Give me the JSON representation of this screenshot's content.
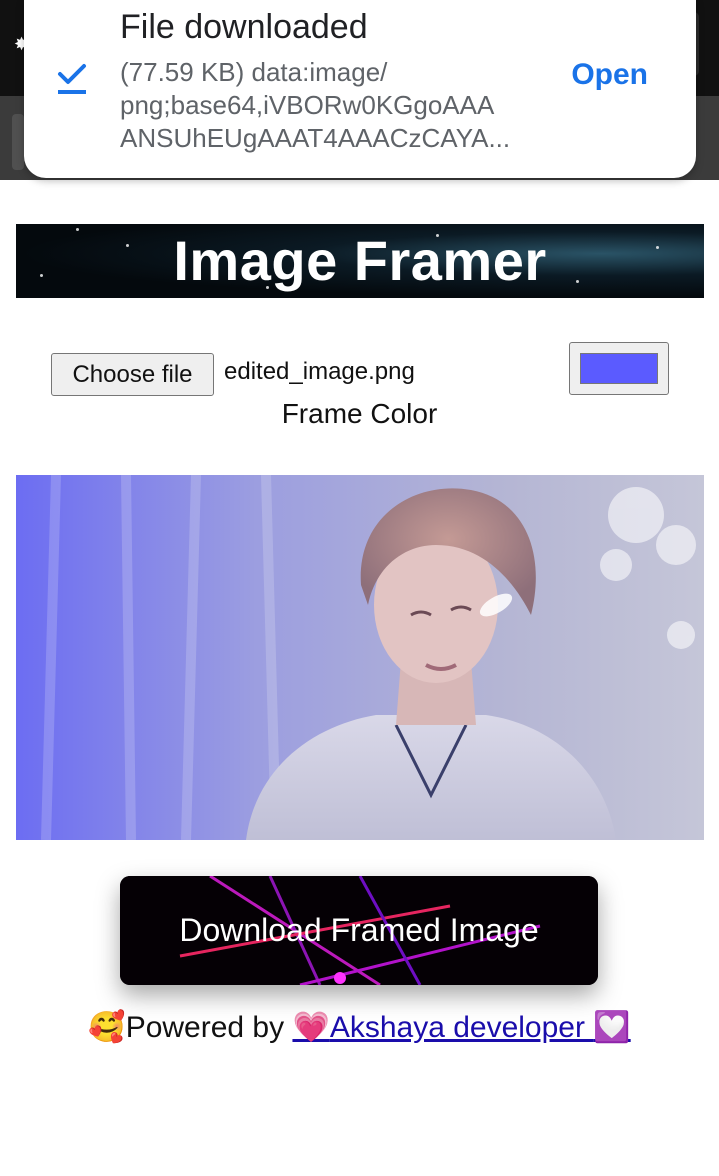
{
  "notification": {
    "title": "File downloaded",
    "detail_lines": [
      "(77.59 KB) data:image/",
      "png;base64,iVBORw0KGgoAAA",
      "ANSUhEUgAAAT4AAACzCAYA..."
    ],
    "open_label": "Open",
    "check_icon": "download-check-icon",
    "accent_color": "#1a73e8"
  },
  "header": {
    "title": "Image Framer"
  },
  "controls": {
    "choose_file_label": "Choose file",
    "file_name": "edited_image.png",
    "frame_color_label": "Frame Color",
    "frame_color_value": "#5b5bff"
  },
  "preview": {
    "icon": "photo-portrait-image"
  },
  "actions": {
    "download_label": "Download Framed Image"
  },
  "footer": {
    "prefix_emoji": "🥰",
    "prefix_text": "Powered by ",
    "link_emoji_left": "💗",
    "link_text": "Akshaya developer ",
    "link_emoji_right": "💟"
  }
}
